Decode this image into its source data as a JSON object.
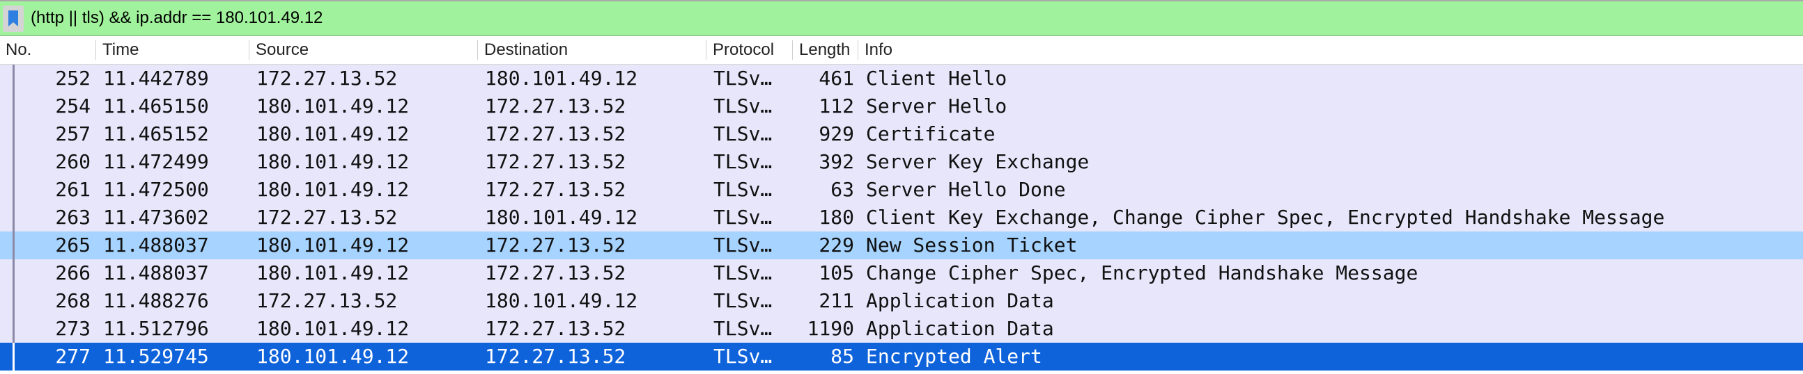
{
  "filter": {
    "text": "(http || tls) && ip.addr == 180.101.49.12",
    "icon": "bookmark-icon",
    "bar_color": "#a0f39c"
  },
  "columns": {
    "no": "No.",
    "time": "Time",
    "source": "Source",
    "destination": "Destination",
    "protocol": "Protocol",
    "length": "Length",
    "info": "Info"
  },
  "colors": {
    "row_bg": "#e7e6fb",
    "selected_light": "#a6d3ff",
    "selected_dark": "#0e63db"
  },
  "packets": [
    {
      "no": "252",
      "time": "11.442789",
      "source": "172.27.13.52",
      "destination": "180.101.49.12",
      "protocol": "TLSv…",
      "length": "461",
      "info": "Client Hello",
      "state": "normal"
    },
    {
      "no": "254",
      "time": "11.465150",
      "source": "180.101.49.12",
      "destination": "172.27.13.52",
      "protocol": "TLSv…",
      "length": "112",
      "info": "Server Hello",
      "state": "normal"
    },
    {
      "no": "257",
      "time": "11.465152",
      "source": "180.101.49.12",
      "destination": "172.27.13.52",
      "protocol": "TLSv…",
      "length": "929",
      "info": "Certificate",
      "state": "normal"
    },
    {
      "no": "260",
      "time": "11.472499",
      "source": "180.101.49.12",
      "destination": "172.27.13.52",
      "protocol": "TLSv…",
      "length": "392",
      "info": "Server Key Exchange",
      "state": "normal"
    },
    {
      "no": "261",
      "time": "11.472500",
      "source": "180.101.49.12",
      "destination": "172.27.13.52",
      "protocol": "TLSv…",
      "length": "63",
      "info": "Server Hello Done",
      "state": "normal"
    },
    {
      "no": "263",
      "time": "11.473602",
      "source": "172.27.13.52",
      "destination": "180.101.49.12",
      "protocol": "TLSv…",
      "length": "180",
      "info": "Client Key Exchange, Change Cipher Spec, Encrypted Handshake Message",
      "state": "normal"
    },
    {
      "no": "265",
      "time": "11.488037",
      "source": "180.101.49.12",
      "destination": "172.27.13.52",
      "protocol": "TLSv…",
      "length": "229",
      "info": "New Session Ticket",
      "state": "highlight"
    },
    {
      "no": "266",
      "time": "11.488037",
      "source": "180.101.49.12",
      "destination": "172.27.13.52",
      "protocol": "TLSv…",
      "length": "105",
      "info": "Change Cipher Spec, Encrypted Handshake Message",
      "state": "normal"
    },
    {
      "no": "268",
      "time": "11.488276",
      "source": "172.27.13.52",
      "destination": "180.101.49.12",
      "protocol": "TLSv…",
      "length": "211",
      "info": "Application Data",
      "state": "normal"
    },
    {
      "no": "273",
      "time": "11.512796",
      "source": "180.101.49.12",
      "destination": "172.27.13.52",
      "protocol": "TLSv…",
      "length": "1190",
      "info": "Application Data",
      "state": "normal"
    },
    {
      "no": "277",
      "time": "11.529745",
      "source": "180.101.49.12",
      "destination": "172.27.13.52",
      "protocol": "TLSv…",
      "length": "85",
      "info": "Encrypted Alert",
      "state": "selected"
    }
  ]
}
